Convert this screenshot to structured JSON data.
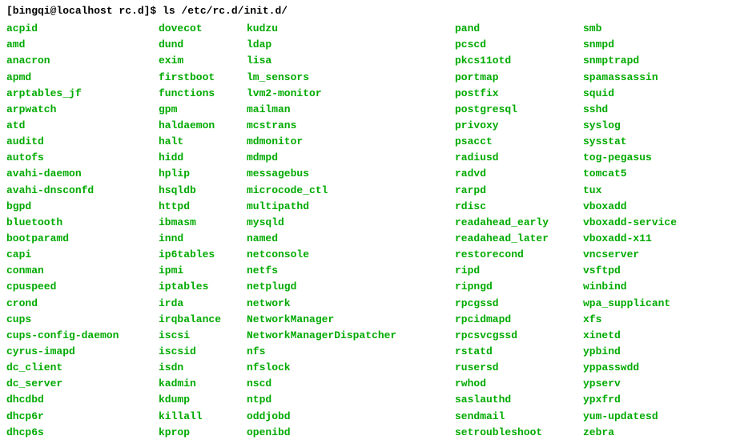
{
  "prompt": {
    "user_host": "[bingqi@localhost rc.d]$",
    "command": "ls /etc/rc.d/init.d/"
  },
  "columns": [
    [
      "acpid",
      "amd",
      "anacron",
      "apmd",
      "arptables_jf",
      "arpwatch",
      "atd",
      "auditd",
      "autofs",
      "avahi-daemon",
      "avahi-dnsconfd",
      "bgpd",
      "bluetooth",
      "bootparamd",
      "capi",
      "conman",
      "cpuspeed",
      "crond",
      "cups",
      "cups-config-daemon",
      "cyrus-imapd",
      "dc_client",
      "dc_server",
      "dhcdbd",
      "dhcp6r",
      "dhcp6s"
    ],
    [
      "dovecot",
      "dund",
      "exim",
      "firstboot",
      "functions",
      "gpm",
      "haldaemon",
      "halt",
      "hidd",
      "hplip",
      "hsqldb",
      "httpd",
      "ibmasm",
      "innd",
      "ip6tables",
      "ipmi",
      "iptables",
      "irda",
      "irqbalance",
      "iscsi",
      "iscsid",
      "isdn",
      "kadmin",
      "kdump",
      "killall",
      "kprop"
    ],
    [
      "kudzu",
      "ldap",
      "lisa",
      "lm_sensors",
      "lvm2-monitor",
      "mailman",
      "mcstrans",
      "mdmonitor",
      "mdmpd",
      "messagebus",
      "microcode_ctl",
      "multipathd",
      "mysqld",
      "named",
      "netconsole",
      "netfs",
      "netplugd",
      "network",
      "NetworkManager",
      "NetworkManagerDispatcher",
      "nfs",
      "nfslock",
      "nscd",
      "ntpd",
      "oddjobd",
      "openibd"
    ],
    [
      "pand",
      "pcscd",
      "pkcs11otd",
      "portmap",
      "postfix",
      "postgresql",
      "privoxy",
      "psacct",
      "radiusd",
      "radvd",
      "rarpd",
      "rdisc",
      "readahead_early",
      "readahead_later",
      "restorecond",
      "ripd",
      "ripngd",
      "rpcgssd",
      "rpcidmapd",
      "rpcsvcgssd",
      "rstatd",
      "rusersd",
      "rwhod",
      "saslauthd",
      "sendmail",
      "setroubleshoot"
    ],
    [
      "smb",
      "snmpd",
      "snmptrapd",
      "spamassassin",
      "squid",
      "sshd",
      "syslog",
      "sysstat",
      "tog-pegasus",
      "tomcat5",
      "tux",
      "vboxadd",
      "vboxadd-service",
      "vboxadd-x11",
      "vncserver",
      "vsftpd",
      "winbind",
      "wpa_supplicant",
      "xfs",
      "xinetd",
      "ypbind",
      "yppasswdd",
      "ypserv",
      "ypxfrd",
      "yum-updatesd",
      "zebra"
    ]
  ]
}
